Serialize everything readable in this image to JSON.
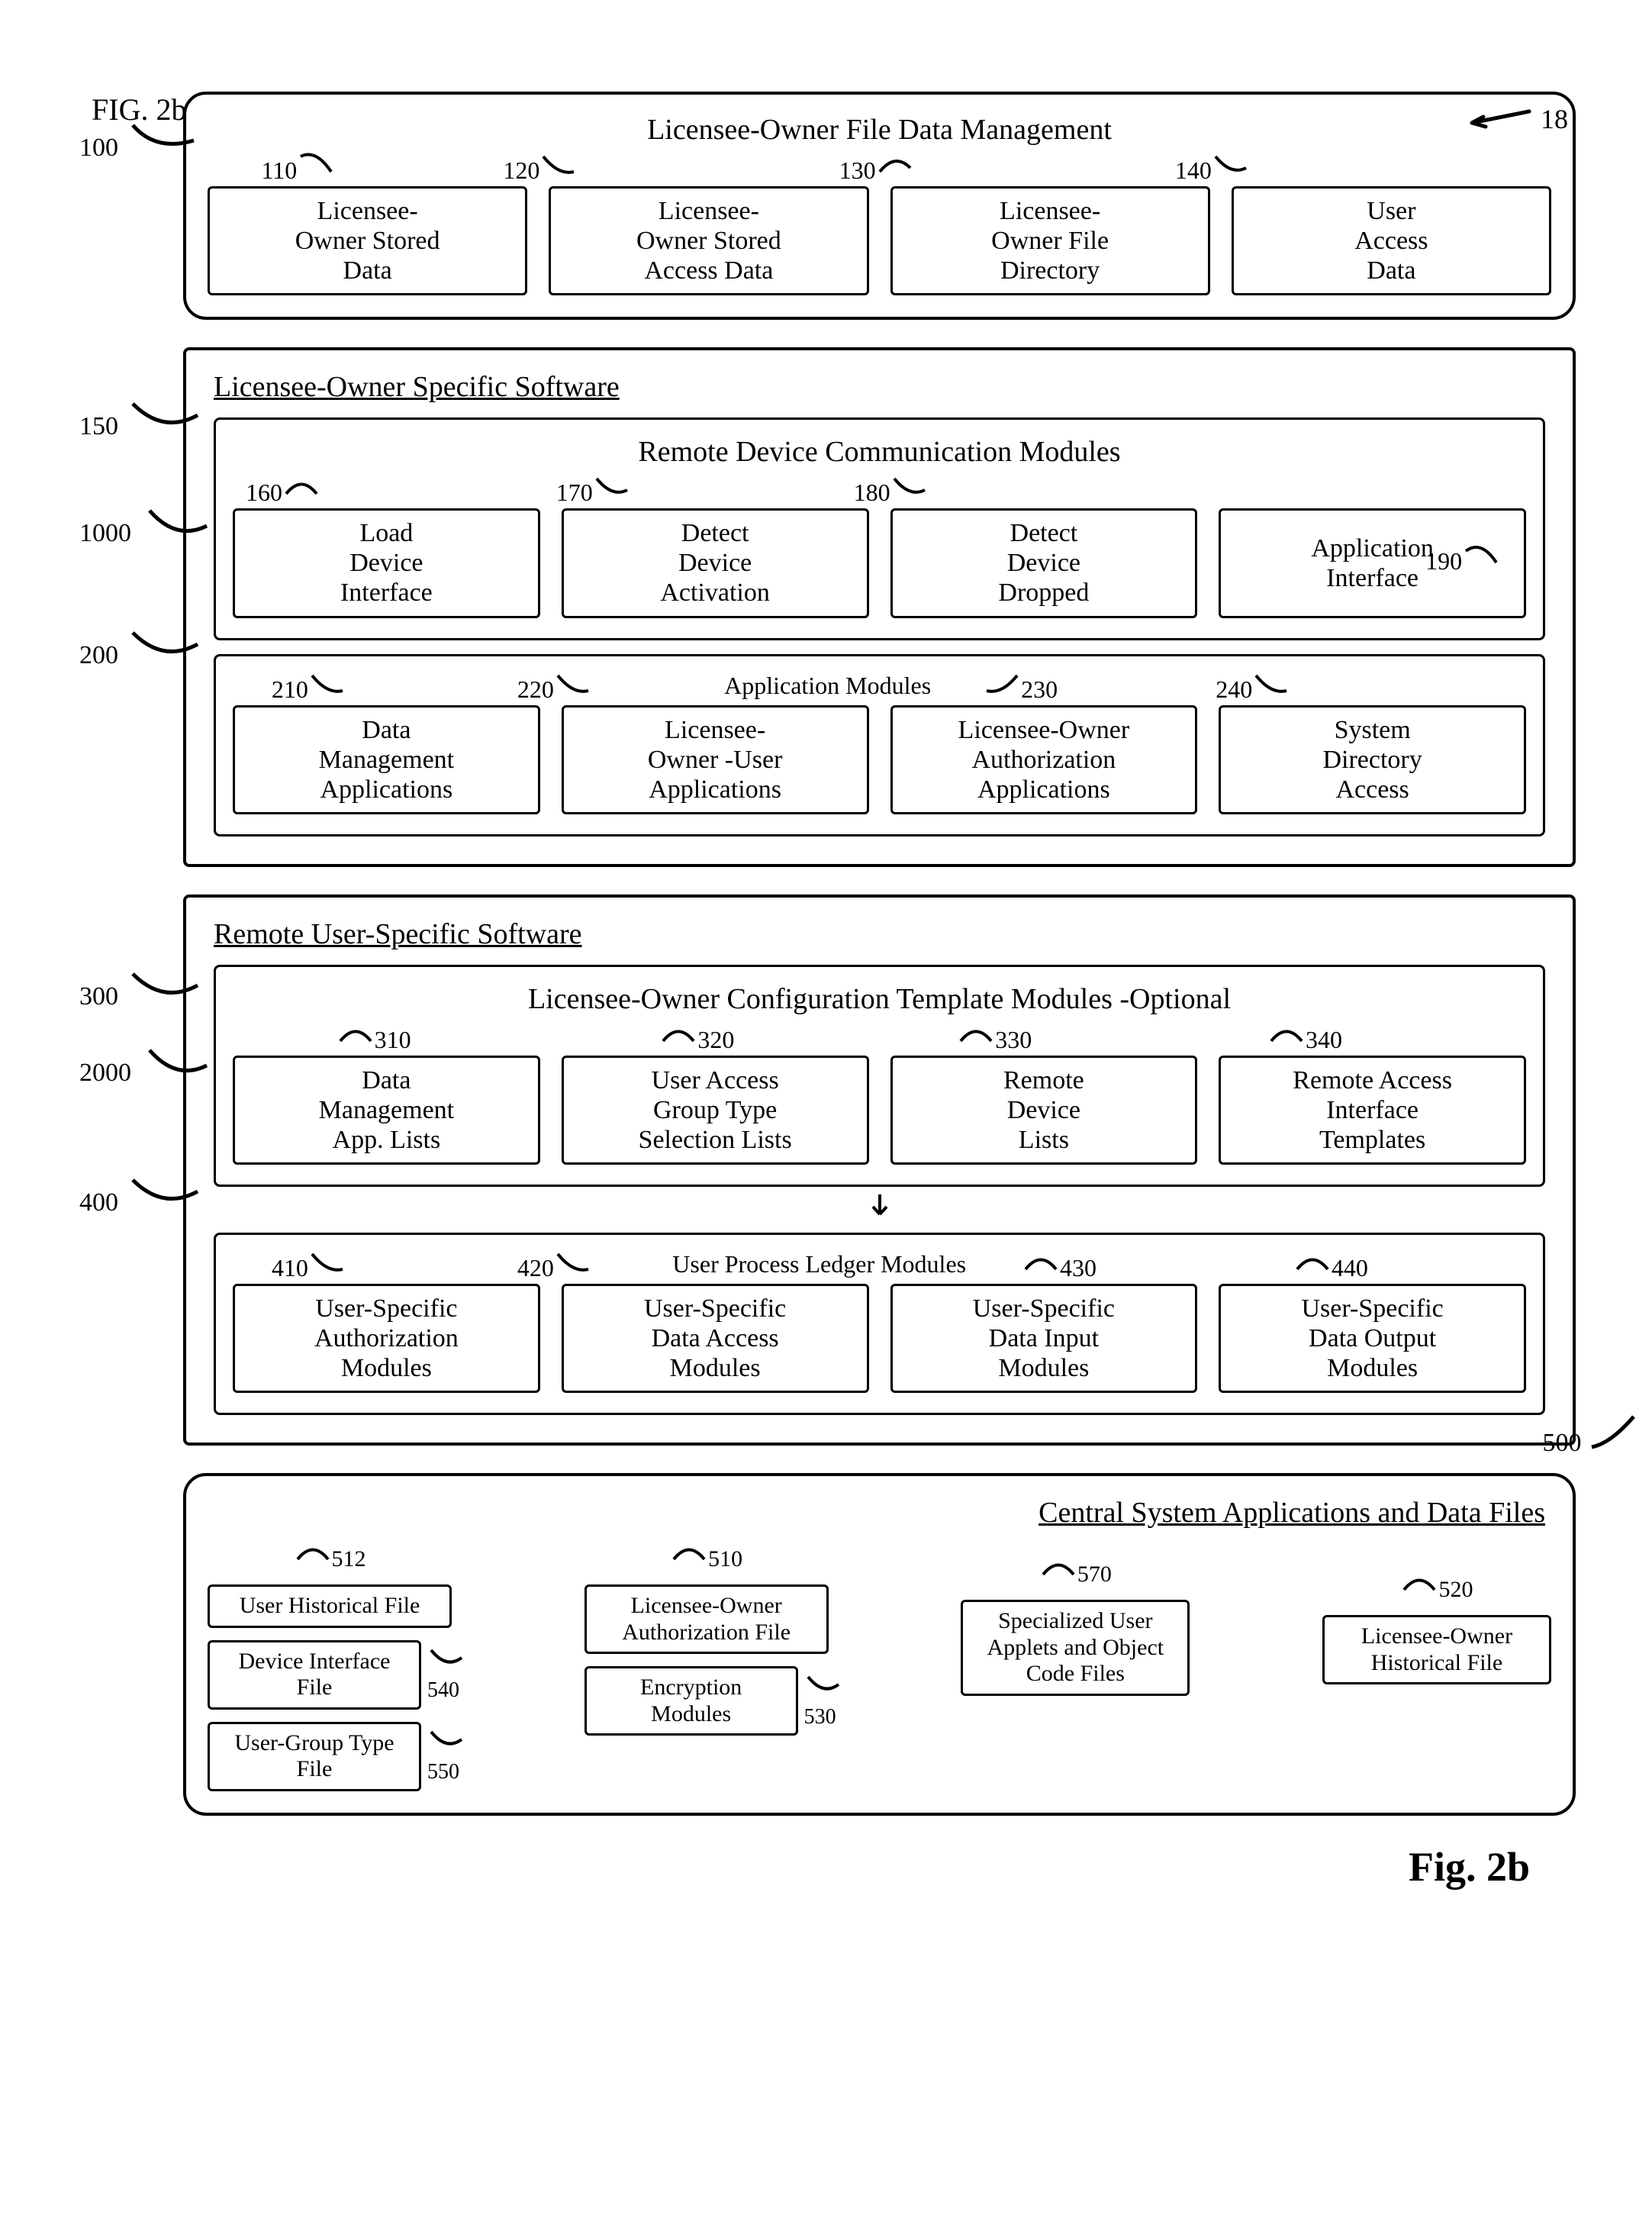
{
  "fig_top": "FIG. 2b",
  "page_ref": "18",
  "fig_bot": "Fig. 2b",
  "left_refs": {
    "r100": "100",
    "r150": "150",
    "r1000": "1000",
    "r200": "200",
    "r300": "300",
    "r2000": "2000",
    "r400": "400"
  },
  "sec100": {
    "title": "Licensee-Owner File Data Management",
    "refs": {
      "r110": "110",
      "r120": "120",
      "r130": "130",
      "r140": "140"
    },
    "b110": "Licensee-\nOwner Stored\nData",
    "b120": "Licensee-\nOwner Stored\nAccess Data",
    "b130": "Licensee-\nOwner File\nDirectory",
    "b140": "User\nAccess\nData"
  },
  "sec_specific_title": "Licensee-Owner Specific Software",
  "sec150": {
    "title": "Remote Device Communication Modules",
    "refs": {
      "r160": "160",
      "r170": "170",
      "r180": "180",
      "r190": "190"
    },
    "b160": "Load\nDevice\nInterface",
    "b170": "Detect\nDevice\nActivation",
    "b180": "Detect\nDevice\nDropped",
    "b190": "Application\nInterface"
  },
  "sec200": {
    "title": "Application Modules",
    "refs": {
      "r210": "210",
      "r220": "220",
      "r230": "230",
      "r240": "240"
    },
    "b210": "Data\nManagement\nApplications",
    "b220": "Licensee-\nOwner -User\nApplications",
    "b230": "Licensee-Owner\nAuthorization\nApplications",
    "b240": "System\nDirectory\nAccess"
  },
  "sec_remote_title": "Remote User-Specific Software",
  "sec300": {
    "title": "Licensee-Owner Configuration Template Modules -Optional",
    "refs": {
      "r310": "310",
      "r320": "320",
      "r330": "330",
      "r340": "340"
    },
    "b310": "Data\nManagement\nApp. Lists",
    "b320": "User Access\nGroup Type\nSelection Lists",
    "b330": "Remote\nDevice\nLists",
    "b340": "Remote Access\nInterface\nTemplates"
  },
  "sec400": {
    "title": "User Process Ledger Modules",
    "refs": {
      "r410": "410",
      "r420": "420",
      "r430": "430",
      "r440": "440"
    },
    "b410": "User-Specific\nAuthorization\nModules",
    "b420": "User-Specific\nData Access\nModules",
    "b430": "User-Specific\nData Input\nModules",
    "b440": "User-Specific\nData Output\nModules"
  },
  "sec500": {
    "ref": "500",
    "title": "Central System Applications and Data Files",
    "refs": {
      "r510": "510",
      "r512": "512",
      "r520": "520",
      "r530": "530",
      "r540": "540",
      "r550": "550",
      "r570": "570"
    },
    "b510": "Licensee-Owner\nAuthorization File",
    "b512": "User Historical File",
    "b520": "Licensee-Owner\nHistorical File",
    "b530": "Encryption\nModules",
    "b540": "Device Interface File",
    "b550": "User-Group Type File",
    "b570": "Specialized User\nApplets and Object\nCode Files"
  }
}
